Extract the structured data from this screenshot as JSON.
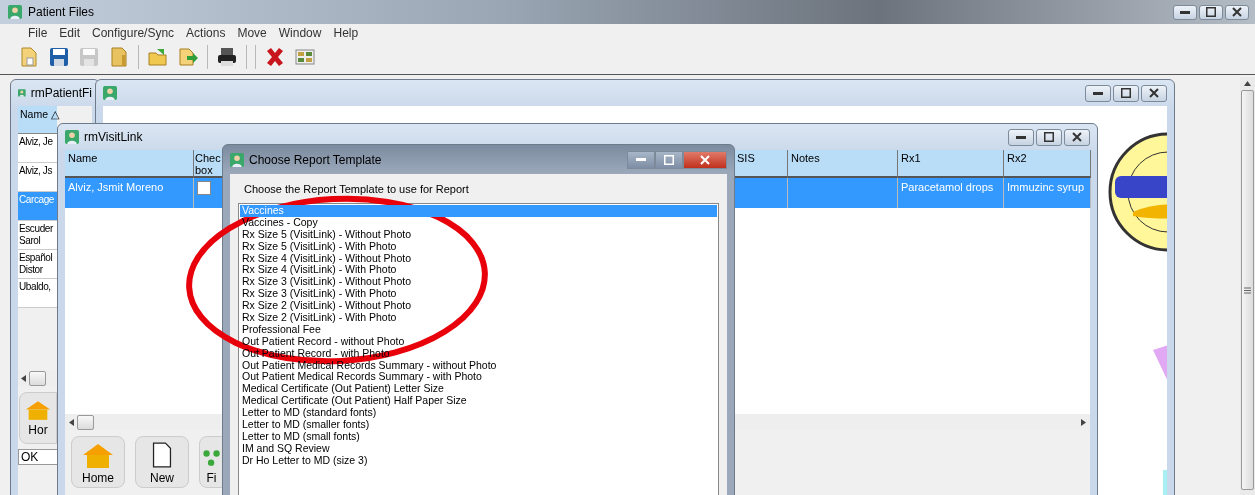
{
  "app": {
    "title": "Patient Files"
  },
  "menu": [
    "File",
    "Edit",
    "Configure/Sync",
    "Actions",
    "Move",
    "Window",
    "Help"
  ],
  "toolbar": [
    {
      "kind": "page",
      "disabled": false
    },
    {
      "kind": "save",
      "disabled": false
    },
    {
      "kind": "save",
      "disabled": true
    },
    {
      "kind": "folder",
      "disabled": false
    },
    {
      "kind": "separator",
      "disabled": false
    },
    {
      "kind": "open",
      "disabled": false
    },
    {
      "kind": "export",
      "disabled": false
    },
    {
      "kind": "separator",
      "disabled": false
    },
    {
      "kind": "print",
      "disabled": false
    },
    {
      "kind": "separator",
      "disabled": false
    },
    {
      "kind": "separator",
      "disabled": false
    },
    {
      "kind": "delete",
      "disabled": false
    },
    {
      "kind": "grid",
      "disabled": false
    }
  ],
  "patient_window": {
    "title": "rmPatientFi",
    "column": "Name",
    "sort_mark": "△",
    "rows": [
      {
        "lines": [
          "Alviz, Je"
        ],
        "selected": false
      },
      {
        "lines": [
          "Alviz, Js"
        ],
        "selected": false
      },
      {
        "lines": [
          "Carcage"
        ],
        "selected": true
      },
      {
        "lines": [
          "Escuder",
          "Sarol"
        ],
        "selected": false
      },
      {
        "lines": [
          "Español",
          "Distor"
        ],
        "selected": false
      },
      {
        "lines": [
          "Ubaldo,"
        ],
        "selected": false
      }
    ],
    "home_button": "Hor",
    "status": "OK"
  },
  "visit_window": {
    "title": "rmVisitLink",
    "columns": [
      "Name",
      "Chec box",
      "SIS",
      "Notes",
      "Rx1",
      "Rx2"
    ],
    "rows": [
      {
        "name": "Alviz, Jsmit Moreno",
        "checked": false,
        "rx1": "Paracetamol drops",
        "rx2": "Immuzinc syrup",
        "selected": true
      }
    ],
    "buttons": [
      {
        "kind": "home",
        "label": "Home"
      },
      {
        "kind": "new",
        "label": "New"
      },
      {
        "kind": "find",
        "label": "Fi"
      }
    ]
  },
  "dialog": {
    "title": "Choose Report Template",
    "prompt": "Choose the Report Template to use for Report",
    "templates": [
      {
        "label": "Vaccines",
        "selected": true
      },
      {
        "label": "Vaccines - Copy",
        "selected": false
      },
      {
        "label": "Rx Size 5  (VisitLink) - Without Photo",
        "selected": false
      },
      {
        "label": "Rx Size 5  (VisitLink) - With Photo",
        "selected": false
      },
      {
        "label": "Rx Size 4  (VisitLink) - Without Photo",
        "selected": false
      },
      {
        "label": "Rx Size 4  (VisitLink) - With Photo",
        "selected": false
      },
      {
        "label": "Rx Size 3  (VisitLink) - Without Photo",
        "selected": false
      },
      {
        "label": "Rx Size 3  (VisitLink) - With Photo",
        "selected": false
      },
      {
        "label": "Rx Size 2 (VisitLink) - Without Photo",
        "selected": false
      },
      {
        "label": "Rx Size 2  (VisitLink) - With Photo",
        "selected": false
      },
      {
        "label": "Professional Fee",
        "selected": false
      },
      {
        "label": "Out Patient Record - without Photo",
        "selected": false
      },
      {
        "label": "Out Patient Record - with Photo",
        "selected": false
      },
      {
        "label": "Out Patient Medical Records Summary - without Photo",
        "selected": false
      },
      {
        "label": "Out Patient Medical Records Summary - with Photo",
        "selected": false
      },
      {
        "label": "Medical Certificate (Out Patient) Letter Size",
        "selected": false
      },
      {
        "label": "Medical Certificate (Out Patient) Half Paper Size",
        "selected": false
      },
      {
        "label": "Letter to MD (standard fonts)",
        "selected": false
      },
      {
        "label": "Letter to MD (smaller fonts)",
        "selected": false
      },
      {
        "label": "Letter to MD (small fonts)",
        "selected": false
      },
      {
        "label": "IM and SQ Review",
        "selected": false
      },
      {
        "label": "Dr Ho Letter to MD (size 3)",
        "selected": false
      }
    ]
  }
}
